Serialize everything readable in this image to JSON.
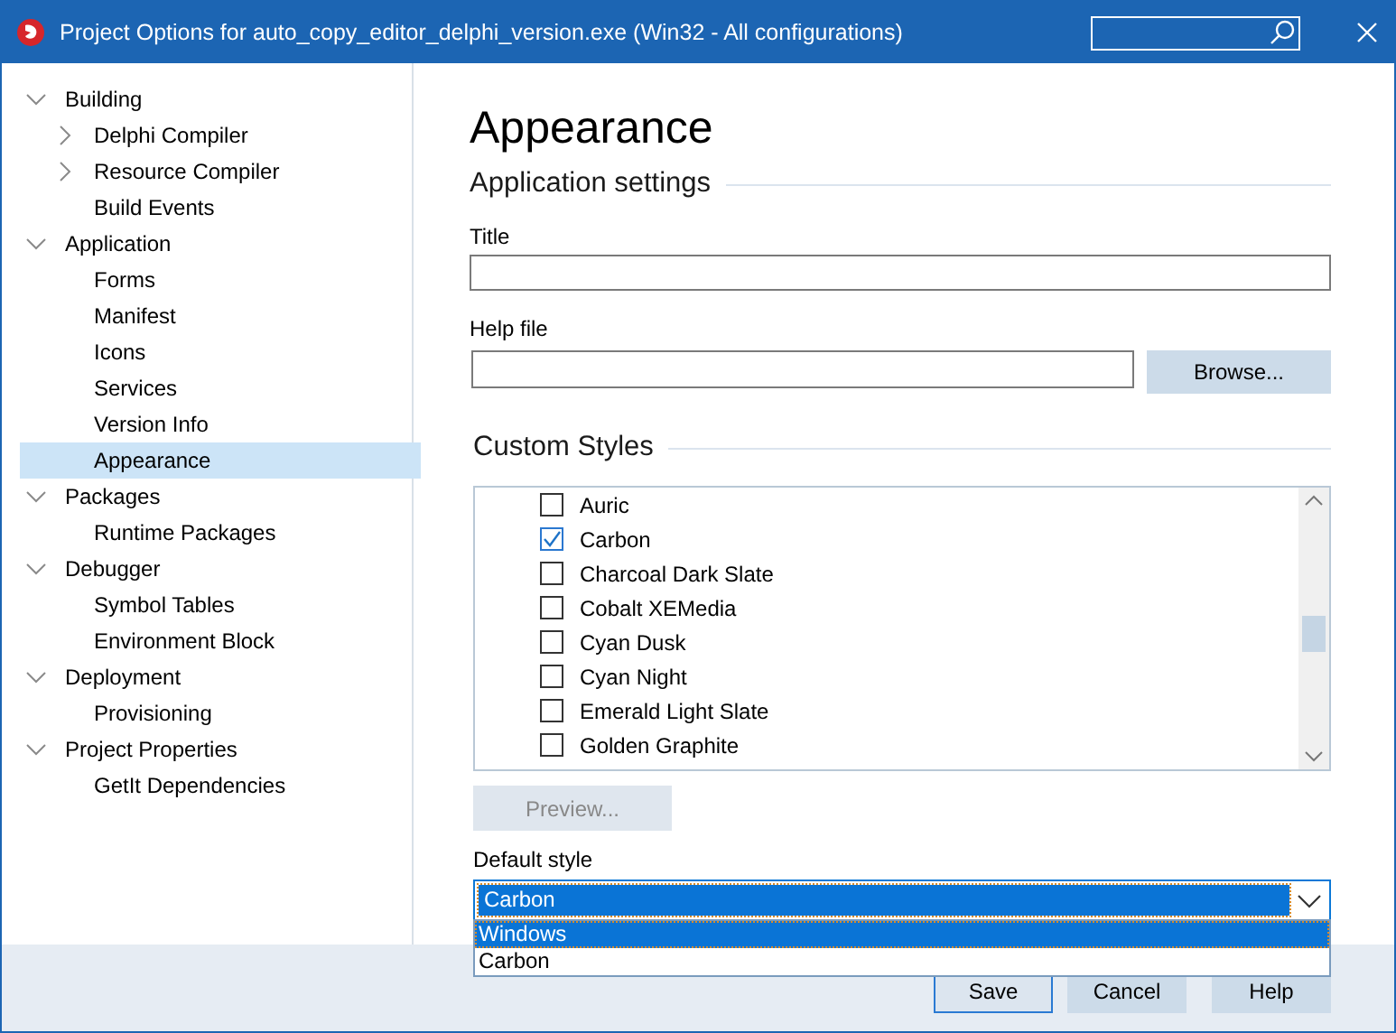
{
  "window": {
    "title": "Project Options for auto_copy_editor_delphi_version.exe  (Win32 - All configurations)"
  },
  "sidebar": {
    "items": [
      {
        "label": "Building",
        "kind": "folder",
        "expanded": true,
        "selected": false,
        "children": [
          {
            "label": "Delphi Compiler",
            "kind": "folder",
            "expanded": false,
            "selected": false
          },
          {
            "label": "Resource Compiler",
            "kind": "folder",
            "expanded": false,
            "selected": false
          },
          {
            "label": "Build Events",
            "kind": "page",
            "selected": false
          }
        ]
      },
      {
        "label": "Application",
        "kind": "folder",
        "expanded": true,
        "selected": false,
        "children": [
          {
            "label": "Forms",
            "kind": "page",
            "selected": false
          },
          {
            "label": "Manifest",
            "kind": "page",
            "selected": false
          },
          {
            "label": "Icons",
            "kind": "page",
            "selected": false
          },
          {
            "label": "Services",
            "kind": "page",
            "selected": false
          },
          {
            "label": "Version Info",
            "kind": "page",
            "selected": false
          },
          {
            "label": "Appearance",
            "kind": "page",
            "selected": true
          }
        ]
      },
      {
        "label": "Packages",
        "kind": "folder",
        "expanded": true,
        "selected": false,
        "children": [
          {
            "label": "Runtime Packages",
            "kind": "page",
            "selected": false
          }
        ]
      },
      {
        "label": "Debugger",
        "kind": "folder",
        "expanded": true,
        "selected": false,
        "children": [
          {
            "label": "Symbol Tables",
            "kind": "page",
            "selected": false
          },
          {
            "label": "Environment Block",
            "kind": "page",
            "selected": false
          }
        ]
      },
      {
        "label": "Deployment",
        "kind": "folder",
        "expanded": true,
        "selected": false,
        "children": [
          {
            "label": "Provisioning",
            "kind": "page",
            "selected": false
          }
        ]
      },
      {
        "label": "Project Properties",
        "kind": "folder",
        "expanded": true,
        "selected": false,
        "children": [
          {
            "label": "GetIt Dependencies",
            "kind": "page",
            "selected": false
          }
        ]
      }
    ]
  },
  "page": {
    "heading": "Appearance",
    "app_settings": {
      "heading": "Application settings",
      "title_label": "Title",
      "help_label": "Help file",
      "browse_button": "Browse..."
    },
    "custom_styles": {
      "heading": "Custom Styles",
      "styles": [
        {
          "name": "Auric",
          "checked": false
        },
        {
          "name": "Carbon",
          "checked": true
        },
        {
          "name": "Charcoal Dark Slate",
          "checked": false
        },
        {
          "name": "Cobalt XEMedia",
          "checked": false
        },
        {
          "name": "Cyan Dusk",
          "checked": false
        },
        {
          "name": "Cyan Night",
          "checked": false
        },
        {
          "name": "Emerald Light Slate",
          "checked": false
        },
        {
          "name": "Golden Graphite",
          "checked": false
        }
      ],
      "preview_button": {
        "label": "Preview...",
        "disabled": true
      }
    },
    "default_style": {
      "label": "Default style",
      "value": "Carbon",
      "expanded": true,
      "options": [
        {
          "label": "Windows",
          "highlighted": true
        },
        {
          "label": "Carbon",
          "highlighted": false
        }
      ]
    }
  },
  "buttons": [
    {
      "label": "Save",
      "default": true
    },
    {
      "label": "Cancel",
      "default": false
    },
    {
      "label": "Help",
      "default": false
    }
  ]
}
